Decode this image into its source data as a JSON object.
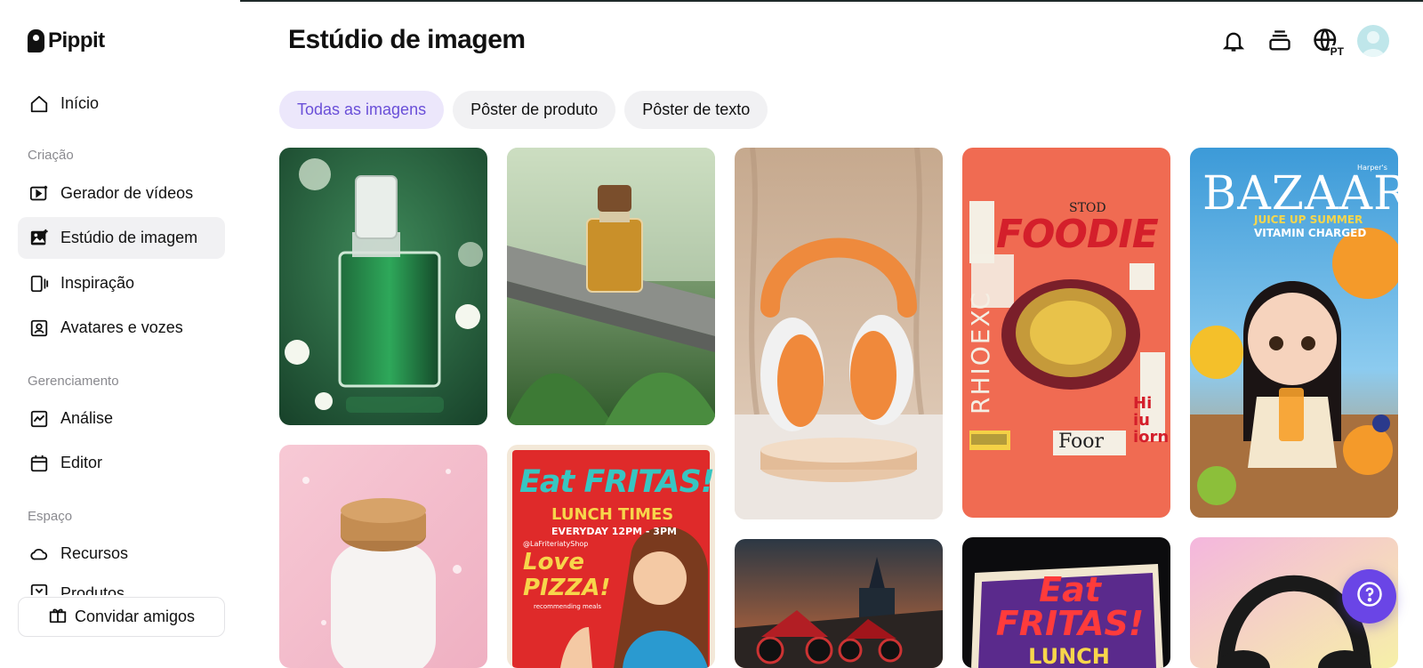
{
  "app": {
    "brand": "Pippit"
  },
  "sidebar": {
    "home": "Início",
    "sections": [
      {
        "label": "Criação",
        "items": [
          "Gerador de vídeos",
          "Estúdio de imagem",
          "Inspiração",
          "Avatares e vozes"
        ]
      },
      {
        "label": "Gerenciamento",
        "items": [
          "Análise",
          "Editor"
        ]
      },
      {
        "label": "Espaço",
        "items": [
          "Recursos",
          "Produtos"
        ]
      }
    ],
    "invite": "Convidar amigos"
  },
  "header": {
    "title": "Estúdio de imagem",
    "language": "PT"
  },
  "tabs": [
    "Todas as imagens",
    "Pôster de produto",
    "Pôster de texto"
  ],
  "gallery": {
    "foodie": {
      "title": "FOODIE",
      "side": "RHIOEXC",
      "tag": "STOD",
      "bottom": "Foor",
      "right": "Hi iu iorn"
    },
    "bazaar": {
      "title": "BAZAAR",
      "sub1": "JUICE UP SUMMER",
      "sub2": "VITAMIN CHARGED",
      "kicker": "Harper's"
    },
    "fritas": {
      "title": "Eat FRITAS!",
      "line1": "LUNCH TIMES",
      "line2": "EVERYDAY 12PM - 3PM",
      "handle": "@LaFriteriatyShop",
      "love": "Love PIZZA!",
      "rec": "recommending meals"
    },
    "fritas2": {
      "title": "Eat FRITAS!",
      "line1": "LUNCH TIMES"
    }
  },
  "colors": {
    "accent": "#6a45e6",
    "active_tab_bg": "#ece7fb",
    "active_tab_text": "#6a4fd8"
  }
}
